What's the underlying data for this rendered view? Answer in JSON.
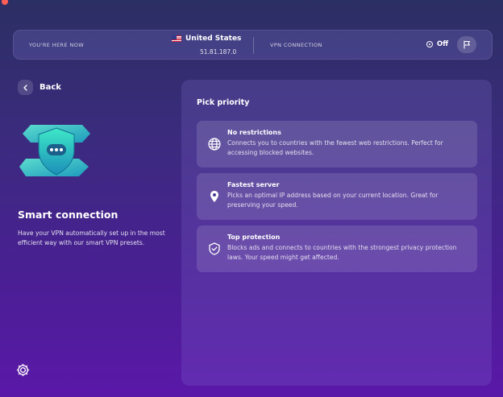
{
  "status_bar": {
    "location_label": "YOU'RE HERE NOW",
    "country": "United States",
    "ip": "51.81.187.0",
    "vpn_label": "VPN CONNECTION",
    "vpn_state": "Off"
  },
  "nav": {
    "back_label": "Back"
  },
  "feature": {
    "title": "Smart connection",
    "description": "Have your VPN automatically set up in the most efficient way with our smart VPN presets."
  },
  "priority": {
    "title": "Pick priority",
    "options": [
      {
        "icon": "globe-icon",
        "name": "No restrictions",
        "description": "Connects you to countries with the fewest web restrictions. Perfect for accessing blocked websites."
      },
      {
        "icon": "location-pin-icon",
        "name": "Fastest server",
        "description": "Picks an optimal IP address based on your current location. Great for preserving your speed."
      },
      {
        "icon": "shield-check-icon",
        "name": "Top protection",
        "description": "Blocks ads and connects to countries with the strongest privacy protection laws. Your speed might get affected."
      }
    ]
  },
  "colors": {
    "background_top": "#2c2f63",
    "background_bottom": "#5a18a8",
    "accent_teal": "#2fd6c2"
  }
}
